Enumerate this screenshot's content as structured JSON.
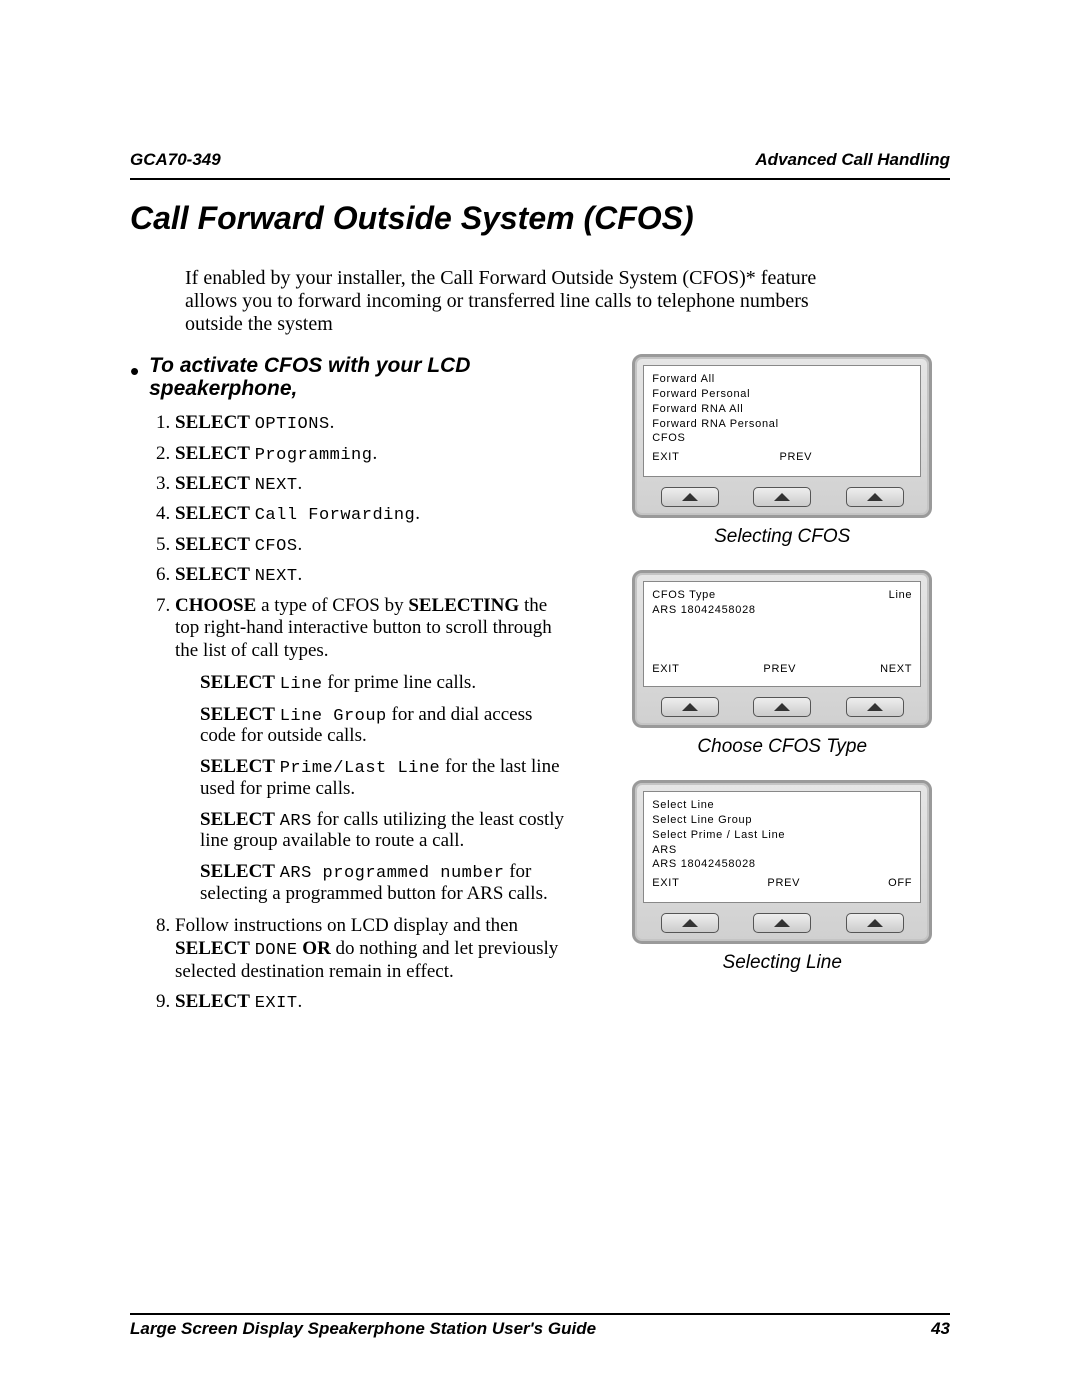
{
  "doc": {
    "code": "GCA70-349",
    "section": "Advanced Call Handling",
    "title": "Call Forward Outside System (CFOS)",
    "intro": "If enabled by your installer, the Call Forward Outside System (CFOS)* feature allows you to forward incoming or transferred line calls to telephone numbers outside the system",
    "footer": "Large Screen Display Speakerphone Station User's Guide",
    "page": "43"
  },
  "subhead": "To activate CFOS with your LCD speakerphone,",
  "steps": {
    "s1a": "SELECT",
    "s1b": "OPTIONS",
    "s2a": "SELECT",
    "s2b": "Programming",
    "s3a": "SELECT",
    "s3b": "NEXT",
    "s4a": "SELECT",
    "s4b": "Call Forwarding",
    "s5a": "SELECT",
    "s5b": "CFOS",
    "s6a": "SELECT",
    "s6b": "NEXT",
    "s7a": "CHOOSE",
    "s7b": " a type of CFOS by ",
    "s7c": "SELECTING",
    "s7d": " the top right-hand interactive button to scroll through the list of call types.",
    "s8a": "Follow instructions on LCD display and then ",
    "s8b": "SELECT",
    "s8c": "DONE",
    "s8d": "OR",
    "s8e": " do nothing and let previously selected destination remain in effect.",
    "s9a": "SELECT",
    "s9b": "EXIT"
  },
  "sub": {
    "p1a": "SELECT",
    "p1b": "Line",
    "p1c": " for prime line calls.",
    "p2a": "SELECT",
    "p2b": "Line Group",
    "p2c": " for and dial access code for outside calls.",
    "p3a": "SELECT",
    "p3b": "Prime/Last Line",
    "p3c": " for the last line used for prime calls.",
    "p4a": "SELECT",
    "p4b": "ARS",
    "p4c": " for calls utilizing the least costly line group available to route a call.",
    "p5a": "SELECT",
    "p5b": "ARS programmed number",
    "p5c": " for selecting a programmed button for ARS calls."
  },
  "lcd1": {
    "l1": "Forward All",
    "l2": "Forward Personal",
    "l3": "Forward RNA All",
    "l4": "Forward RNA Personal",
    "l5": "CFOS",
    "f1": "EXIT",
    "f2": "PREV",
    "f3": "",
    "caption": "Selecting CFOS"
  },
  "lcd2": {
    "r1a": "CFOS Type",
    "r1b": "Line",
    "l2": "ARS 18042458028",
    "f1": "EXIT",
    "f2": "PREV",
    "f3": "NEXT",
    "caption": "Choose CFOS Type"
  },
  "lcd3": {
    "l1": "Select Line",
    "l2": "Select Line Group",
    "l3": "Select Prime / Last Line",
    "l4": "ARS",
    "l5": "ARS 18042458028",
    "f1": "EXIT",
    "f2": "PREV",
    "f3": "OFF",
    "caption": "Selecting Line"
  }
}
